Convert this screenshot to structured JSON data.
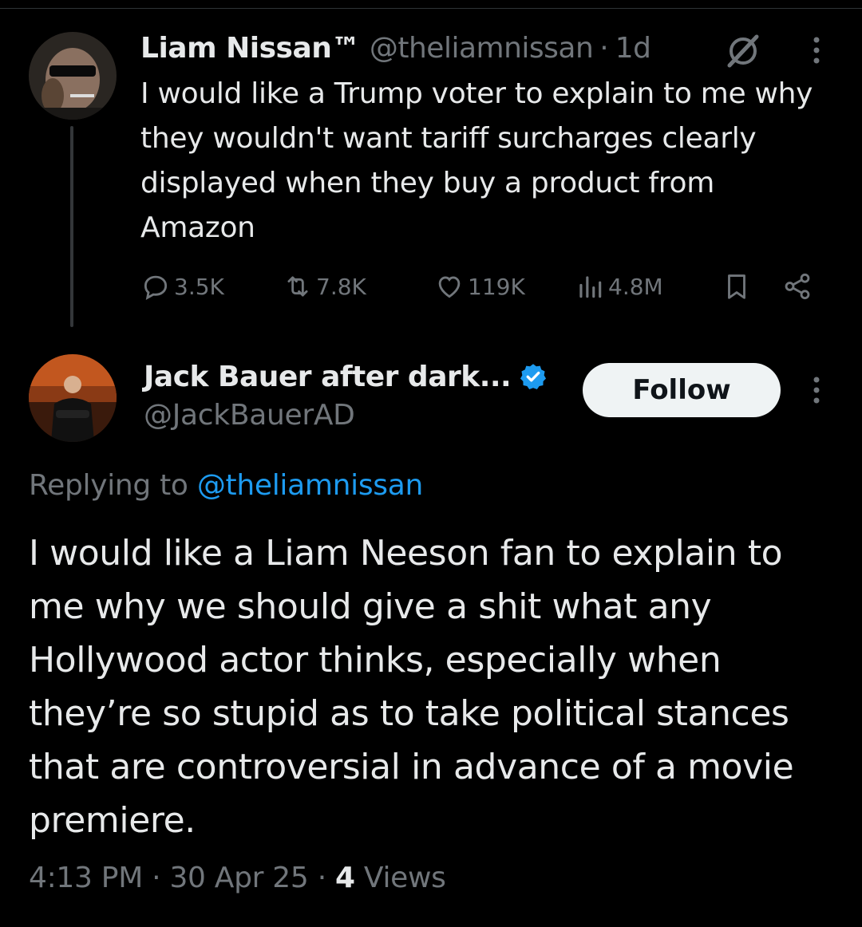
{
  "parent_tweet": {
    "author_name": "Liam Nissan™",
    "handle": "@theliamnissan",
    "separator": "·",
    "time_ago": "1d",
    "text": "I would like a Trump voter to explain to me why they wouldn't want tariff surcharges clearly displayed when they buy a product from Amazon",
    "replies": "3.5K",
    "reposts": "7.8K",
    "likes": "119K",
    "views": "4.8M"
  },
  "reply_tweet": {
    "author_name": "Jack Bauer after dark...",
    "handle": "@JackBauerAD",
    "follow_label": "Follow",
    "replying_prefix": "Replying to ",
    "replying_to": "@theliamnissan",
    "text": "I would like a Liam Neeson fan to explain to me why we should give a shit what any Hollywood actor thinks, especially when they’re so stupid as to take political stances that are controversial in advance of a movie premiere.",
    "time": "4:13 PM",
    "date": "30 Apr 25",
    "view_count": "4",
    "views_label": "Views",
    "separator": "·"
  },
  "colors": {
    "background": "#000000",
    "text_primary": "#e7e9ea",
    "text_secondary": "#71767b",
    "accent_blue": "#1d9bf0",
    "follow_button_bg": "#eff3f4"
  },
  "icons": {
    "grok": "grok-icon",
    "more": "more-dots-icon",
    "reply": "reply-icon",
    "repost": "repost-icon",
    "like": "heart-icon",
    "views": "views-icon",
    "bookmark": "bookmark-icon",
    "share": "share-icon",
    "verified": "verified-badge-icon"
  }
}
